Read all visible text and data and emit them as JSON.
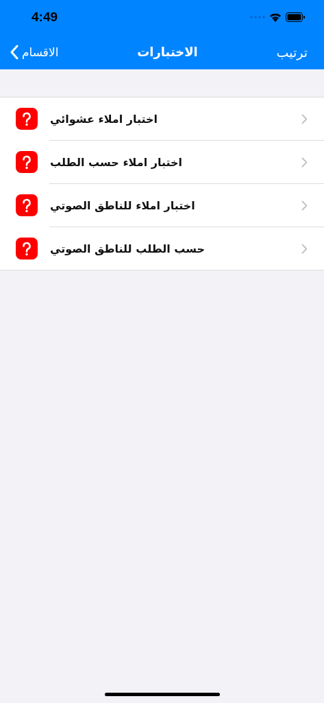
{
  "status_bar": {
    "time": "4:49"
  },
  "nav": {
    "back": "الاقسام",
    "title": "الاختبارات",
    "action": "ترتيب"
  },
  "items": [
    {
      "label": "اختبار املاء عشوائي"
    },
    {
      "label": "اختبار املاء حسب الطلب"
    },
    {
      "label": "اختبار املاء للناطق الصوتي"
    },
    {
      "label": "حسب الطلب للناطق الصوتي"
    }
  ]
}
